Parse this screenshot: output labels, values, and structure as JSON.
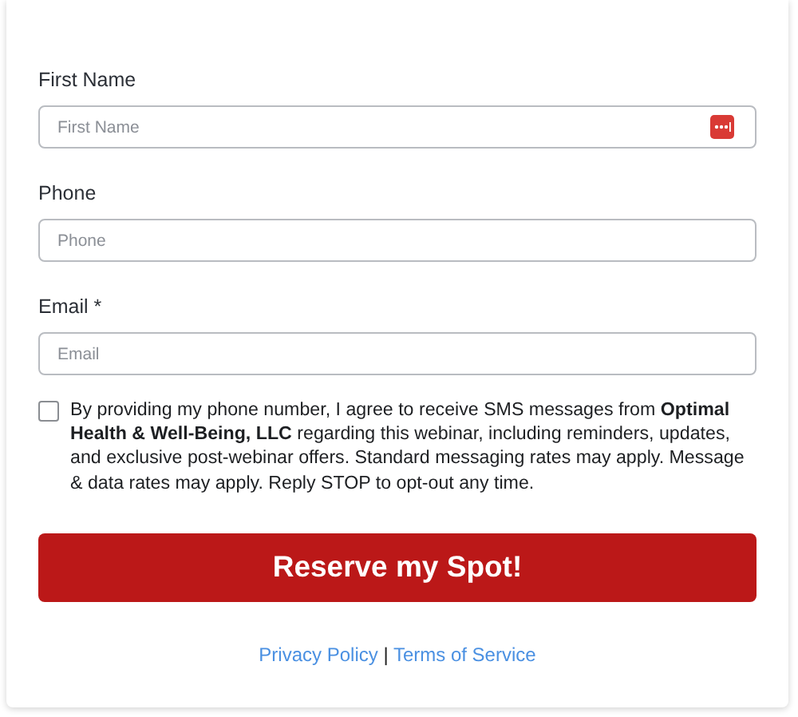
{
  "fields": [
    {
      "label": "First Name",
      "placeholder": "First Name",
      "autofill_icon": true
    },
    {
      "label": "Phone",
      "placeholder": "Phone",
      "autofill_icon": false
    },
    {
      "label": "Email *",
      "placeholder": "Email",
      "autofill_icon": false
    }
  ],
  "consent": {
    "checked": false,
    "text": "By providing my phone number, I agree to receive SMS messages from **Optimal Health & Well-Being, LLC** regarding this webinar, including reminders, updates, and exclusive post-webinar offers. Standard messaging rates may apply. Message & data rates may apply. Reply STOP to opt-out any time."
  },
  "submit_button": "Reserve my Spot!",
  "footer_links": [
    "Privacy Policy",
    "Terms of Service"
  ],
  "footer_separator": "|"
}
